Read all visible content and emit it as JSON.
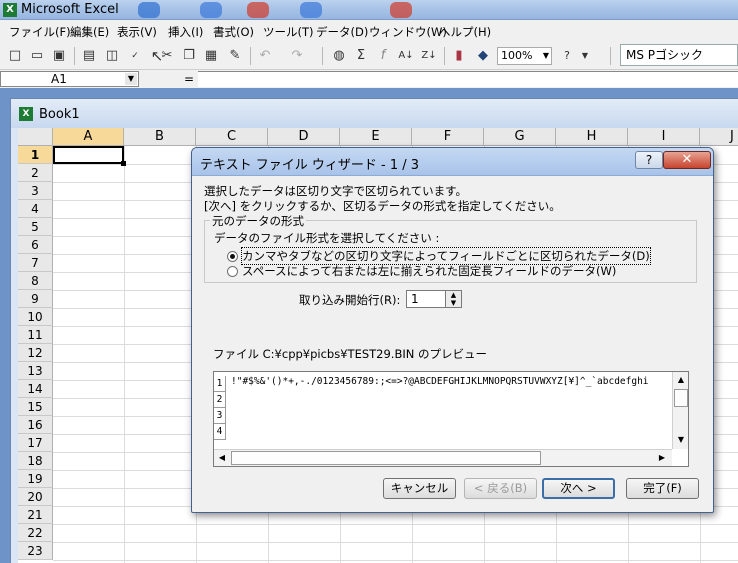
{
  "app": {
    "title": "Microsoft Excel",
    "icon": "excel-icon"
  },
  "menu": [
    "ファイル(F)",
    "編集(E)",
    "表示(V)",
    "挿入(I)",
    "書式(O)",
    "ツール(T)",
    "データ(D)",
    "ウィンドウ(W)",
    "ヘルプ(H)"
  ],
  "toolbar": {
    "zoom": "100%",
    "font": "MS Pゴシック"
  },
  "formula": {
    "namebox": "A1",
    "eq": "="
  },
  "book": {
    "title": "Book1"
  },
  "grid": {
    "columns": [
      "A",
      "B",
      "C",
      "D",
      "E",
      "F",
      "G",
      "H",
      "I",
      "J"
    ],
    "rows": [
      "1",
      "2",
      "3",
      "4",
      "5",
      "6",
      "7",
      "8",
      "9",
      "10",
      "11",
      "12",
      "13",
      "14",
      "15",
      "16",
      "17",
      "18",
      "19",
      "20",
      "21",
      "22",
      "23"
    ],
    "selected_cell": "A1"
  },
  "dialog": {
    "title": "テキスト ファイル ウィザード - 1 / 3",
    "help": "?",
    "close": "✕",
    "line1": "選択したデータは区切り文字で区切られています。",
    "line2": "[次へ] をクリックするか、区切るデータの形式を指定してください。",
    "group_label": "元のデータの形式",
    "group_prompt": "データのファイル形式を選択してください :",
    "option_delimited": "カンマやタブなどの区切り文字によってフィールドごとに区切られたデータ(D)",
    "option_fixed": "スペースによって右または左に揃えられた固定長フィールドのデータ(W)",
    "start_row_label": "取り込み開始行(R):",
    "start_row_value": "1",
    "preview_label": "ファイル C:¥cpp¥picbs¥TEST29.BIN のプレビュー",
    "preview_rows": [
      {
        "num": "1",
        "text": "!\"#$%&'()*+,-./0123456789:;<=>?@ABCDEFGHIJKLMNOPQRSTUVWXYZ[¥]^_`abcdefghi"
      },
      {
        "num": "2",
        "text": ""
      },
      {
        "num": "3",
        "text": ""
      },
      {
        "num": "4",
        "text": ""
      }
    ],
    "buttons": {
      "cancel": "キャンセル",
      "back": "< 戻る(B)",
      "next": "次へ >",
      "finish": "完了(F)"
    }
  }
}
